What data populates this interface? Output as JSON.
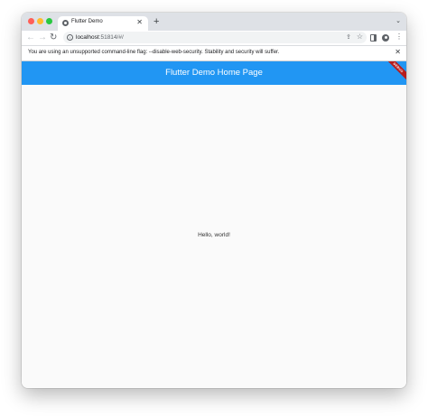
{
  "colors": {
    "traffic_close": "#ff5f57",
    "traffic_minimize": "#febc2e",
    "traffic_zoom": "#28c840",
    "appbar": "#2196f3",
    "debug_banner": "#b71c1c"
  },
  "browser": {
    "tab": {
      "title": "Flutter Demo",
      "close_icon": "✕",
      "favicon": "globe-icon"
    },
    "new_tab_icon": "+",
    "tab_menu_icon": "⌄",
    "toolbar": {
      "back_icon": "←",
      "forward_icon": "→",
      "reload_icon": "↻",
      "info_icon": "i",
      "url_host": "localhost",
      "url_path": ":51814/#/",
      "share_icon": "⇪",
      "bookmark_icon": "☆",
      "menu_icon": "⋮"
    },
    "infobar": {
      "message": "You are using an unsupported command-line flag: --disable-web-security. Stability and security will suffer.",
      "close_icon": "✕"
    }
  },
  "app": {
    "title": "Flutter Demo Home Page",
    "debug_banner": "DEBUG",
    "body_text": "Hello, world!"
  }
}
